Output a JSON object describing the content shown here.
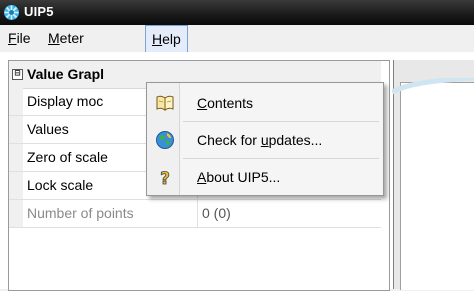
{
  "window": {
    "title": "UIP5",
    "app_icon": "snowflake-gear-icon"
  },
  "menubar": {
    "items": [
      {
        "label": "File",
        "mnemonic": "F",
        "rest": "ile"
      },
      {
        "label": "Meter",
        "mnemonic": "M",
        "rest": "eter"
      },
      {
        "label": "Help",
        "mnemonic": "H",
        "rest": "elp",
        "active": true
      }
    ]
  },
  "help_menu": {
    "items": [
      {
        "label": "Contents",
        "pre": "",
        "mnemonic": "C",
        "post": "ontents",
        "icon": "book-icon"
      },
      {
        "label": "Check for updates...",
        "pre": "Check for ",
        "mnemonic": "u",
        "post": "pdates...",
        "icon": "globe-update-icon"
      },
      {
        "label": "About UIP5...",
        "pre": "",
        "mnemonic": "A",
        "post": "bout UIP5...",
        "icon": "help-question-icon"
      }
    ]
  },
  "property_grid": {
    "group": {
      "label": "Value Graph",
      "visible_label": "Value Grapl",
      "toggle": "⊟"
    },
    "rows": [
      {
        "name": "Display moc",
        "value": "",
        "disabled": false
      },
      {
        "name": "Values",
        "value": "",
        "disabled": false
      },
      {
        "name": "Zero of scale",
        "value": "",
        "disabled": false
      },
      {
        "name": "Lock scale",
        "value": "",
        "disabled": false
      },
      {
        "name": "Number of points",
        "value": "0 (0)",
        "disabled": true
      }
    ]
  },
  "colors": {
    "titlebar": "#1c1c1c",
    "menu_active_bg": "#e3ecf8",
    "menu_active_border": "#7aa4d8",
    "dropdown_bg": "#f5f5f5",
    "disabled_text": "#8a8a8a"
  }
}
